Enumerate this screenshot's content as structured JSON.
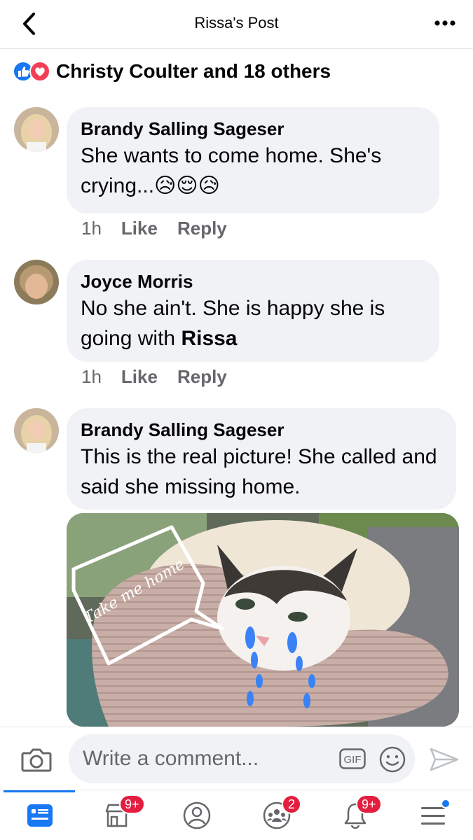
{
  "header": {
    "title": "Rissa's Post"
  },
  "reactions": {
    "text": "Christy Coulter and 18 others"
  },
  "comments": [
    {
      "author": "Brandy Salling Sageser",
      "text": "She wants to come home. She's crying...😥😌😥",
      "time": "1h",
      "like": "Like",
      "reply": "Reply"
    },
    {
      "author": "Joyce Morris",
      "text_before": "No she ain't. She is happy she is going with ",
      "mention": "Rissa",
      "time": "1h",
      "like": "Like",
      "reply": "Reply"
    },
    {
      "author": "Brandy Salling Sageser",
      "text": "This is the real picture! She called and said she missing home."
    }
  ],
  "photo": {
    "caption_overlay": "Take me home"
  },
  "composer": {
    "placeholder": "Write a comment...",
    "gif_label": "GIF"
  },
  "nav": {
    "marketplace_badge": "9+",
    "groups_badge": "2",
    "notifications_badge": "9+"
  },
  "colors": {
    "accent": "#1877f2",
    "badge": "#e41e3f",
    "bubble": "#f0f2f5",
    "meta": "#65676b"
  }
}
